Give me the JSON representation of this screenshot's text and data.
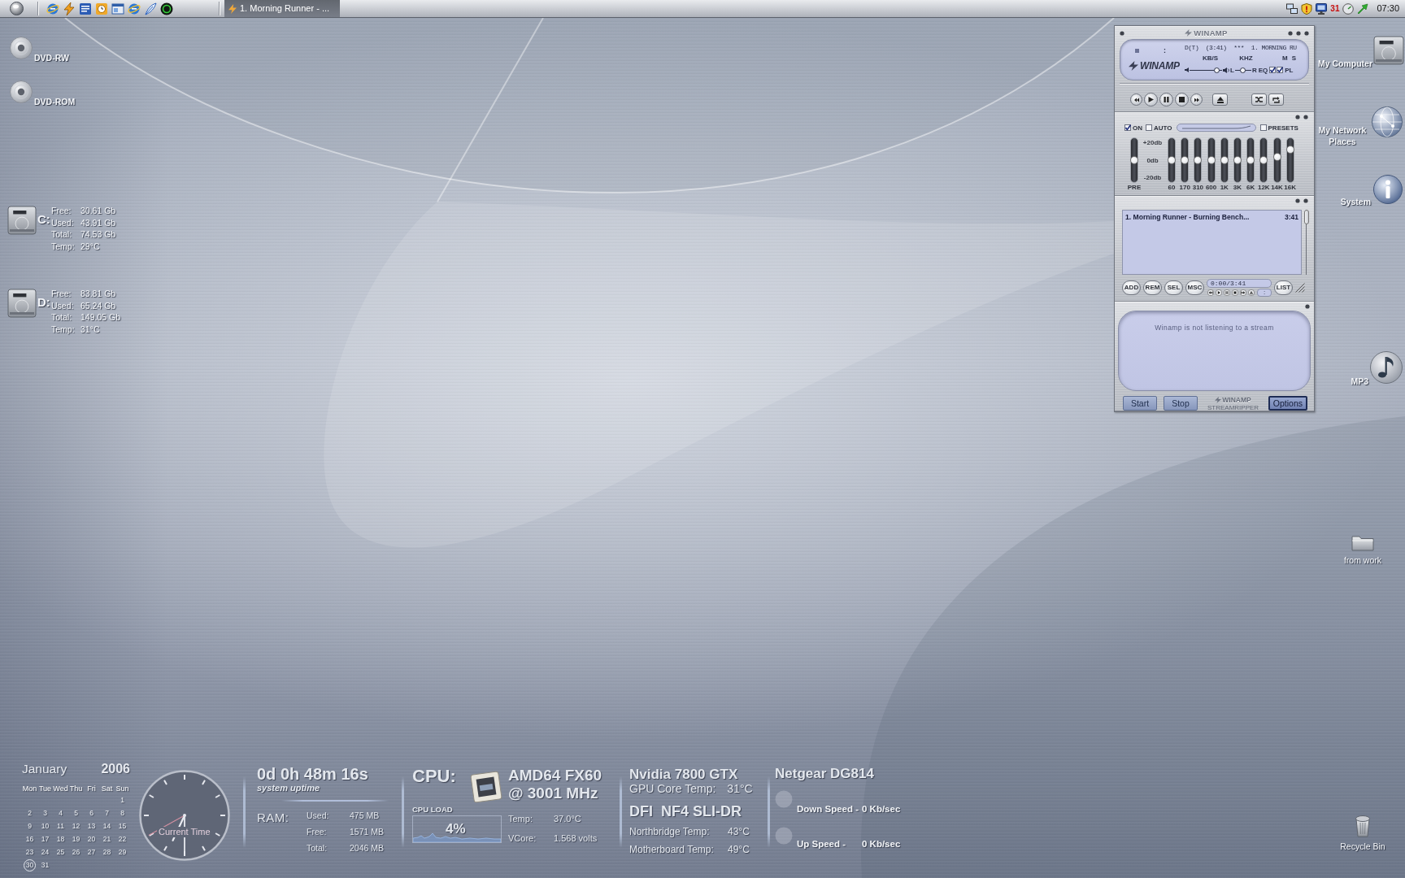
{
  "taskbar": {
    "tasks": [
      {
        "label": "1. Morning Runner - ...",
        "selected": true
      }
    ],
    "tray_date": "31",
    "clock": "07:30"
  },
  "desktop_icons": [
    {
      "label": "DVD-RW",
      "kind": "disc"
    },
    {
      "label": "DVD-ROM",
      "kind": "disc"
    },
    {
      "label": "My Computer",
      "kind": "computer"
    },
    {
      "label": "My Network Places",
      "kind": "network"
    },
    {
      "label": "System",
      "kind": "info"
    },
    {
      "label": "MP3",
      "kind": "music"
    },
    {
      "label": "from work",
      "kind": "folder"
    },
    {
      "label": "Recycle Bin",
      "kind": "trash"
    }
  ],
  "drives": [
    {
      "letter": "C:",
      "rows": [
        {
          "label": "Free:",
          "value": "30.61 Gb"
        },
        {
          "label": "Used:",
          "value": "43.91 Gb"
        },
        {
          "label": "Total:",
          "value": "74.53 Gb"
        },
        {
          "label": "Temp:",
          "value": "29°C"
        }
      ]
    },
    {
      "letter": "D:",
      "rows": [
        {
          "label": "Free:",
          "value": "83.81 Gb"
        },
        {
          "label": "Used:",
          "value": "65.24 Gb"
        },
        {
          "label": "Total:",
          "value": "149.05 Gb"
        },
        {
          "label": "Temp:",
          "value": "31°C"
        }
      ]
    }
  ],
  "winamp": {
    "title": "WINAMP",
    "display": {
      "time": ":",
      "logo": "WINAMP",
      "ticker": "D(T)  (3:41)  ***  1. MORNING RU",
      "bitrate_label": "KB/S",
      "samplerate_label": "KHZ",
      "channel_modes": [
        "M",
        "S"
      ],
      "volume": {
        "level": 0.92
      },
      "balance": {
        "left": "L",
        "right": "R",
        "level": 0.5
      },
      "toggles": [
        {
          "label": "EQ",
          "checked": true
        },
        {
          "label": "PL",
          "checked": true
        }
      ]
    },
    "equalizer": {
      "options": [
        {
          "label": "ON",
          "checked": true
        },
        {
          "label": "AUTO",
          "checked": false
        }
      ],
      "presets": {
        "label": "PRESETS",
        "checked": false
      },
      "scale": [
        "+20db",
        "0db",
        "-20db"
      ],
      "preamp": {
        "label": "PRE",
        "level": 0.5
      },
      "bands": [
        {
          "label": "60",
          "level": 0.5
        },
        {
          "label": "170",
          "level": 0.5
        },
        {
          "label": "310",
          "level": 0.5
        },
        {
          "label": "600",
          "level": 0.5
        },
        {
          "label": "1K",
          "level": 0.5
        },
        {
          "label": "3K",
          "level": 0.5
        },
        {
          "label": "6K",
          "level": 0.5
        },
        {
          "label": "12K",
          "level": 0.5
        },
        {
          "label": "14K",
          "level": 0.6
        },
        {
          "label": "16K",
          "level": 0.8
        }
      ]
    },
    "playlist": {
      "items": [
        {
          "title": "1. Morning Runner - Burning Bench...",
          "duration": "3:41",
          "selected": false
        }
      ],
      "buttons": [
        "ADD",
        "REM",
        "SEL",
        "MSC"
      ],
      "position": "0:00/3:41",
      "mini_time": ":",
      "list_button": "LIST"
    },
    "streamripper": {
      "message": "Winamp is not listening to a stream",
      "buttons": [
        {
          "label": "Start",
          "default": false
        },
        {
          "label": "Stop",
          "default": false
        },
        {
          "label": "Options",
          "default": true
        }
      ],
      "logo": "WINAMP",
      "logo_caption": "STREAMRIPPER"
    }
  },
  "widgets": {
    "calendar": {
      "month": "January",
      "year": "2006",
      "weekdays": [
        "Mon",
        "Tue",
        "Wed",
        "Thu",
        "Fri",
        "Sat",
        "Sun"
      ],
      "weeks": [
        [
          {
            "day": "1",
            "today": false
          }
        ],
        [
          {
            "day": "2",
            "today": false
          },
          {
            "day": "3",
            "today": false
          },
          {
            "day": "4",
            "today": false
          },
          {
            "day": "5",
            "today": false
          },
          {
            "day": "6",
            "today": false
          },
          {
            "day": "7",
            "today": false
          },
          {
            "day": "8",
            "today": false
          }
        ],
        [
          {
            "day": "9",
            "today": false
          },
          {
            "day": "10",
            "today": false
          },
          {
            "day": "11",
            "today": false
          },
          {
            "day": "12",
            "today": false
          },
          {
            "day": "13",
            "today": false
          },
          {
            "day": "14",
            "today": false
          },
          {
            "day": "15",
            "today": false
          }
        ],
        [
          {
            "day": "16",
            "today": false
          },
          {
            "day": "17",
            "today": false
          },
          {
            "day": "18",
            "today": false
          },
          {
            "day": "19",
            "today": false
          },
          {
            "day": "20",
            "today": false
          },
          {
            "day": "21",
            "today": false
          },
          {
            "day": "22",
            "today": false
          }
        ],
        [
          {
            "day": "23",
            "today": false
          },
          {
            "day": "24",
            "today": false
          },
          {
            "day": "25",
            "today": false
          },
          {
            "day": "26",
            "today": false
          },
          {
            "day": "27",
            "today": false
          },
          {
            "day": "28",
            "today": false
          },
          {
            "day": "29",
            "today": false
          }
        ],
        [
          {
            "day": "30",
            "today": true
          },
          {
            "day": "31",
            "today": false
          }
        ]
      ]
    },
    "clock": {
      "label": "Current Time"
    },
    "uptime": {
      "value": "0d 0h 48m 16s",
      "caption": "system uptime"
    },
    "ram": {
      "label": "RAM:",
      "rows": [
        {
          "label": "Used:",
          "value": "475 MB"
        },
        {
          "label": "Free:",
          "value": "1571 MB"
        },
        {
          "label": "Total:",
          "value": "2046 MB"
        }
      ]
    },
    "cpu": {
      "title": "CPU:",
      "load_label": "CPU LOAD",
      "load": "4%",
      "model": "AMD64 FX60",
      "speed": "@ 3001 MHz",
      "rows": [
        {
          "label": "Temp:",
          "value": "37.0°C"
        },
        {
          "label": "VCore:",
          "value": "1.568 volts"
        }
      ]
    },
    "gpu": {
      "title": "Nvidia 7800 GTX",
      "rows": [
        {
          "label": "GPU Core Temp:",
          "value": "31°C"
        }
      ]
    },
    "board": {
      "title": "DFI  NF4 SLI-DR",
      "rows": [
        {
          "label": "Northbridge Temp:",
          "value": "43°C"
        },
        {
          "label": "Motherboard Temp:",
          "value": "49°C"
        }
      ]
    },
    "network": {
      "title": "Netgear DG814",
      "rows": [
        {
          "label": "Down Speed -",
          "value": "0 Kb/sec"
        },
        {
          "label": "Up Speed -",
          "value": "0 Kb/sec"
        }
      ]
    }
  }
}
